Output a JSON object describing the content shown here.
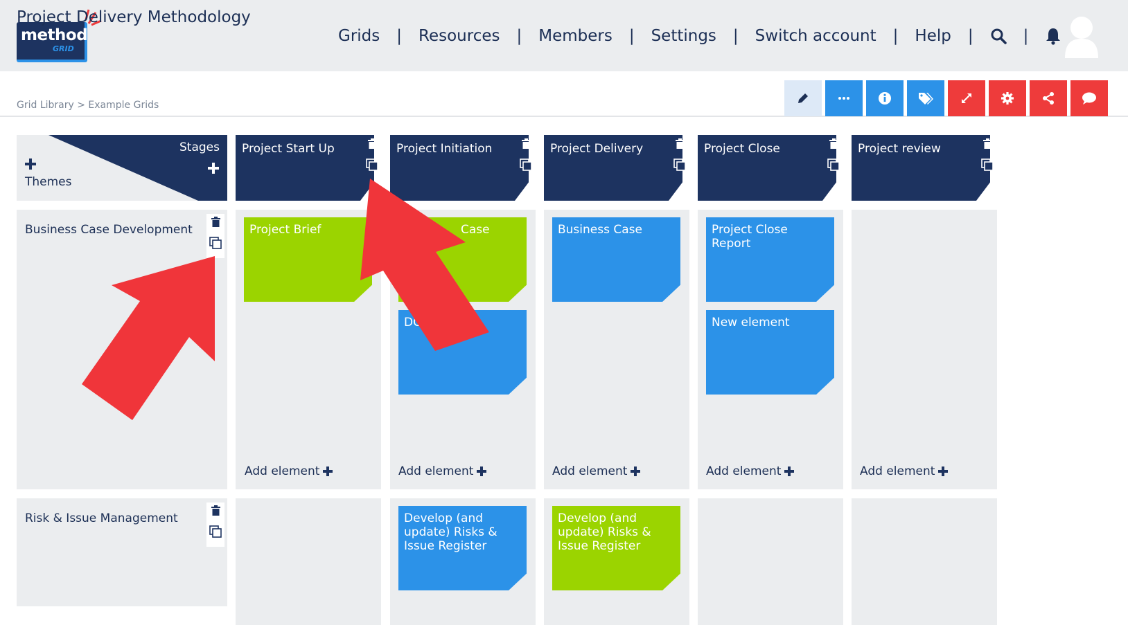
{
  "logo": {
    "word": "method",
    "sub": "GRID"
  },
  "nav": {
    "items": [
      "Grids",
      "Resources",
      "Members",
      "Settings",
      "Switch account",
      "Help"
    ],
    "separator": "|"
  },
  "title": "Project Delivery Methodology",
  "breadcrumb": "Grid Library > Example Grids",
  "toolbar": [
    {
      "icon": "pencil-icon",
      "color": "#dde9f7"
    },
    {
      "icon": "more-icon",
      "color": "#2c92e8"
    },
    {
      "icon": "info-icon",
      "color": "#2c92e8"
    },
    {
      "icon": "tag-icon",
      "color": "#2c92e8"
    },
    {
      "icon": "expand-icon",
      "color": "#ee3b3b"
    },
    {
      "icon": "gear-icon",
      "color": "#ee3b3b"
    },
    {
      "icon": "share-icon",
      "color": "#ee3b3b"
    },
    {
      "icon": "comment-icon",
      "color": "#ee3b3b"
    }
  ],
  "corner": {
    "stages": "Stages",
    "themes": "Themes"
  },
  "stages": [
    "Project Start Up",
    "Project Initiation",
    "Project Delivery",
    "Project Close",
    "Project review"
  ],
  "themes": [
    "Business Case Development",
    "Risk & Issue Management"
  ],
  "cards": {
    "project_brief": "Project Brief",
    "initiation_case": "Case",
    "initiation_dc": "DC",
    "business_case": "Business Case",
    "close_report": "Project Close Report",
    "new_element": "New element",
    "risk_initiation": "Develop (and update) Risks & Issue Register",
    "risk_delivery": "Develop (and update) Risks & Issue Register"
  },
  "add_element": "Add element",
  "colors": {
    "navy": "#1d3360",
    "green": "#9bd400",
    "blue": "#2c92e8",
    "red": "#ee3b3b",
    "arrow": "#f0353a"
  }
}
